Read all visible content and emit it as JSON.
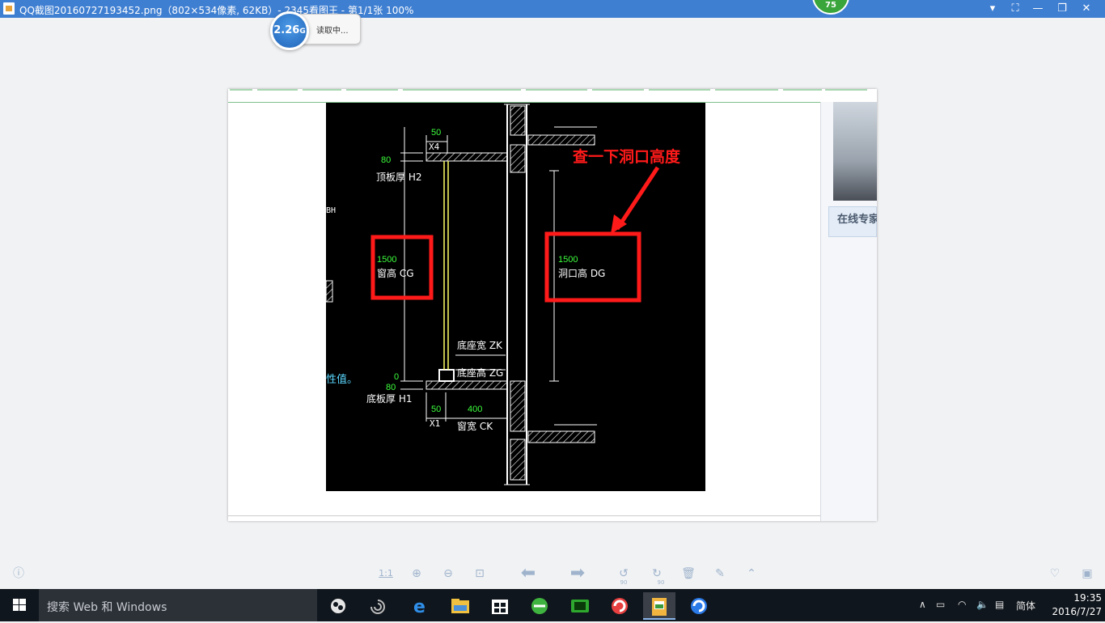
{
  "window": {
    "title": "QQ截图20160727193452.png（802×534像素, 62KB）- 2345看图王 - 第1/1张 100%",
    "speed_value": "2.26",
    "speed_unit": "G",
    "speed_status": "读取中...",
    "badge": "75"
  },
  "image": {
    "sidebar_text": "在线专家",
    "cad": {
      "annotation": "查一下洞口高度",
      "labels": {
        "top_dim": "50",
        "x4": "X4",
        "d80_top": "80",
        "roof_thk": "顶板厚 H2",
        "bh": "BH",
        "win_val": "1500",
        "win_height": "窗高 CG",
        "open_val": "1500",
        "open_height": "洞口高 DG",
        "base_width": "底座宽 ZK",
        "base_height": "底座高 ZG",
        "zero": "0",
        "d80_bottom": "80",
        "prop_value": "性值。",
        "floor_thk": "底板厚  H1",
        "d50": "50",
        "d400": "400",
        "x1": "X1",
        "win_width": "窗宽 CK"
      }
    }
  },
  "toolbar": {
    "ratio": "1:1",
    "rot_left": "90",
    "rot_right": "90"
  },
  "taskbar": {
    "search_placeholder": "搜索 Web 和 Windows",
    "ime": "简体",
    "time": "19:35",
    "date": "2016/7/27"
  },
  "colors": {
    "titlebar": "#3f7fd2",
    "cad_bg": "#000000",
    "cad_green": "#3cff3c",
    "annotation_red": "#ff1a1a",
    "taskbar": "#10161d"
  }
}
